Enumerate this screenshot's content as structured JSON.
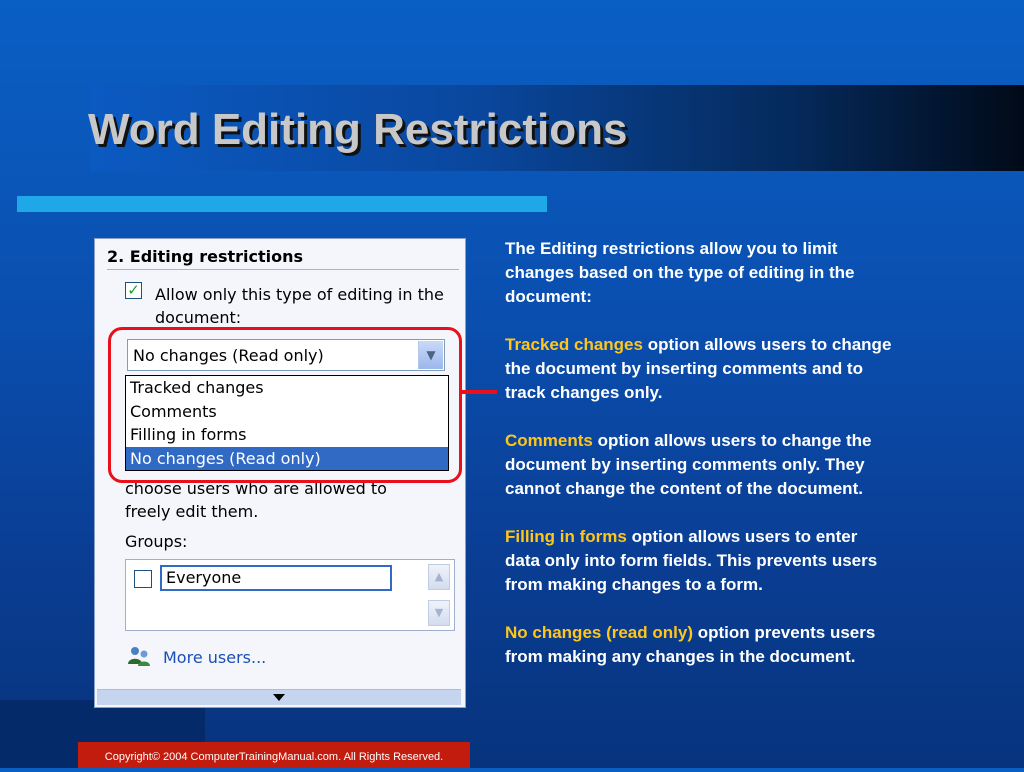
{
  "slide": {
    "title": "Word Editing Restrictions"
  },
  "panel": {
    "heading": "2. Editing restrictions",
    "checkbox_label": "Allow only this type of editing in the document:",
    "checkbox_checked": true,
    "combo_value": "No changes (Read only)",
    "list_options": [
      "Tracked changes",
      "Comments",
      "Filling in forms",
      "No changes (Read only)"
    ],
    "selected_index": 3,
    "partial_text": "choose users who are allowed to freely edit them.",
    "groups_label": "Groups:",
    "group_entry": "Everyone",
    "more_users": "More users..."
  },
  "description": {
    "intro": "The Editing restrictions allow you to limit changes based on the type of editing in the document:",
    "items": [
      {
        "term": "Tracked changes",
        "text": " option allows users to change the document by inserting comments and to track changes only."
      },
      {
        "term": "Comments",
        "text": " option allows users to change the document by inserting comments only.  They cannot change the content of the document."
      },
      {
        "term": "Filling in forms",
        "text": " option allows users to enter data only into form fields. This prevents users from making changes to a form."
      },
      {
        "term": "No changes (read only)",
        "text": " option prevents users from making any changes in the document."
      }
    ]
  },
  "footer": {
    "copyright": "Copyright© 2004 ComputerTrainingManual.com. All Rights Reserved."
  },
  "colors": {
    "background": "#0a4fb0",
    "accent_bar": "#1fa8e8",
    "highlight_term": "#ffc61a",
    "callout_ring": "#e8101a",
    "footer": "#c21c0e"
  }
}
